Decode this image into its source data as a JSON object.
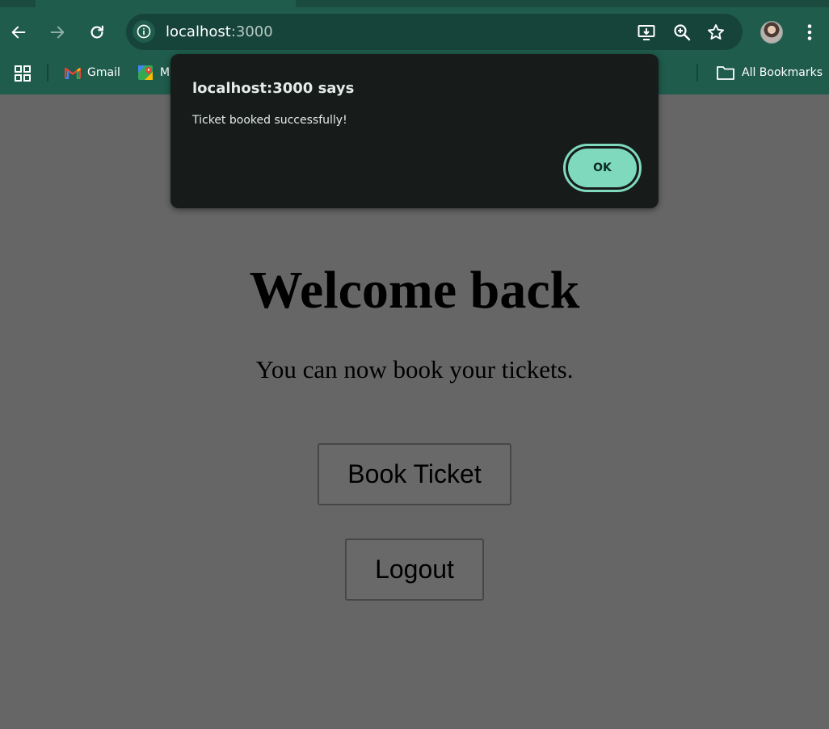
{
  "browser": {
    "url_host": "localhost",
    "url_port": ":3000",
    "bookmarks": {
      "gmail": "Gmail",
      "maps": "M",
      "all_bookmarks": "All Bookmarks"
    }
  },
  "page": {
    "heading": "Welcome back",
    "subtext": "You can now book your tickets.",
    "book_button": "Book Ticket",
    "logout_button": "Logout"
  },
  "dialog": {
    "title": "localhost:3000 says",
    "message": "Ticket booked successfully!",
    "ok_label": "OK"
  },
  "colors": {
    "toolbar": "#1f5c4c",
    "omnibox": "#16443a",
    "page_overlay": "#666666",
    "dialog_bg": "#171c1b",
    "ok_accent": "#7fd9bd"
  }
}
